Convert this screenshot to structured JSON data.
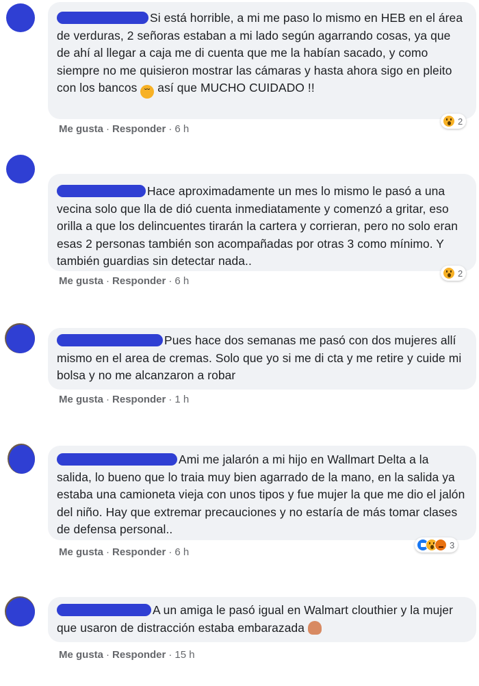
{
  "comments": [
    {
      "text": "Si está horrible, a mi me paso lo mismo en HEB en el área de verduras, 2 señoras estaban a mi lado según agarrando cosas, ya que de ahí al llegar a caja me di cuenta que me la habían sacado, y como siempre no me quisieron mostrar las cámaras y hasta ahora sigo en pleito con los bancos",
      "text_after_emoji": " así que MUCHO CUIDADO !!",
      "like": "Me gusta",
      "reply": "Responder",
      "time": "6 h",
      "reaction_count": "2",
      "inline_emoji": "sad-face-emoji",
      "reaction_icons": [
        "wow-reaction-icon"
      ]
    },
    {
      "text": "Hace aproximadamente un mes lo mismo le pasó a una vecina solo que lla de dió cuenta inmediatamente y comenzó a gritar, eso orilla a que los delincuentes tirarán la cartera y corrieran, pero no solo eran esas 2 personas también son acompañadas por otras 3 como mínimo. Y también guardias sin detectar nada..",
      "like": "Me gusta",
      "reply": "Responder",
      "time": "6 h",
      "reaction_count": "2",
      "reaction_icons": [
        "wow-reaction-icon"
      ]
    },
    {
      "text": "Pues hace dos semanas me pasó con dos mujeres allí mismo en el area de cremas. Solo que yo si me di cta y me retire y cuide mi bolsa y no me alcanzaron a robar",
      "like": "Me gusta",
      "reply": "Responder",
      "time": "1 h"
    },
    {
      "text": "Ami me jalarón a mi hijo en Wallmart Delta a la salida, lo bueno que lo traia muy bien agarrado de la mano, en la salida ya estaba una camioneta vieja con unos tipos y fue mujer la que me dio el jalón del niño. Hay que extremar precauciones y no estaría de más tomar clases de defensa personal..",
      "like": "Me gusta",
      "reply": "Responder",
      "time": "6 h",
      "reaction_count": "3",
      "reaction_icons": [
        "like-reaction-icon",
        "wow-reaction-icon",
        "angry-reaction-icon"
      ]
    },
    {
      "text": "A un amiga le pasó igual en Walmart clouthier y la mujer que usaron de distracción estaba embarazada",
      "like": "Me gusta",
      "reply": "Responder",
      "time": "15 h",
      "inline_emoji": "person-frowning-emoji"
    }
  ],
  "colors": {
    "redaction": "#2f3fd3",
    "bubble": "#f0f2f5",
    "meta_text": "#65676b",
    "wow": "#f7b125",
    "like": "#1877f2",
    "angry": "#e9710f"
  }
}
